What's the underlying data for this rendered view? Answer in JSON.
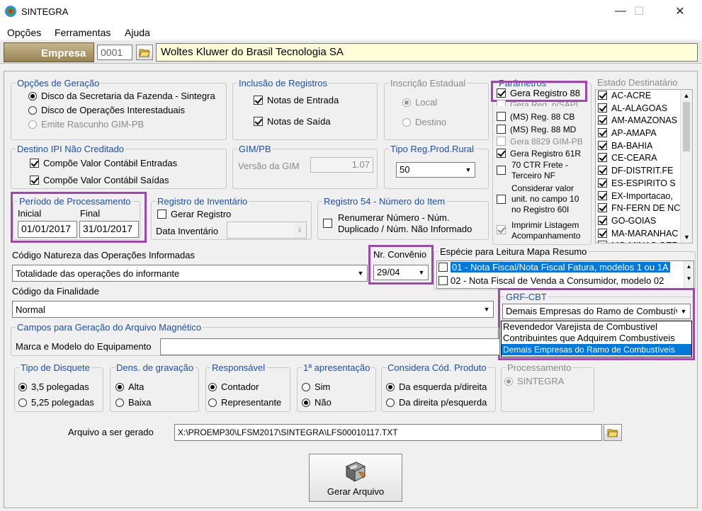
{
  "window": {
    "title": "SINTEGRA",
    "minimize": "—",
    "maximize": "☐",
    "close": "✕"
  },
  "menu": [
    "Opções",
    "Ferramentas",
    "Ajuda"
  ],
  "empresa": {
    "label": "Empresa",
    "code": "0001",
    "name": "Woltes Kluwer do Brasil Tecnologia SA"
  },
  "opcoes": {
    "legend": "Opções de Geração",
    "items": [
      "Disco da Secretaria da Fazenda - Sintegra",
      "Disco de Operações Interestaduais",
      "Emite Rascunho GIM-PB"
    ]
  },
  "inclusao": {
    "legend": "Inclusão de Registros",
    "items": [
      "Notas de Entrada",
      "Notas de Saída"
    ]
  },
  "inscricao": {
    "legend": "Inscrição Estadual",
    "items": [
      "Local",
      "Destino"
    ]
  },
  "parametros": {
    "legend": "Parâmetros",
    "items": [
      "Gera Registro 88",
      "Gera Reg. p/SAPI",
      "(MS) Reg. 88 CB",
      "(MS) Reg. 88 MD",
      "Gera 8829 GIM-PB",
      "Gera Registro 61R",
      "70 CTR Frete - Terceiro NF",
      "Considerar valor unit. no campo 10 no Registro 60I",
      "Imprimir Listagem Acompanhamento"
    ]
  },
  "estado": {
    "legend": "Estado Destinatário",
    "items": [
      "AC-ACRE",
      "AL-ALAGOAS",
      "AM-AMAZONAS",
      "AP-AMAPA",
      "BA-BAHIA",
      "CE-CEARA",
      "DF-DISTRIT.FE",
      "ES-ESPIRITO S",
      "EX-Importacao,",
      "FN-FERN DE NC",
      "GO-GOIAS",
      "MA-MARANHAC",
      "MG-MINAS GER"
    ]
  },
  "destino_ipi": {
    "legend": "Destino IPI Não Creditado",
    "items": [
      "Compõe Valor Contábil Entradas",
      "Compõe Valor Contábil Saídas"
    ]
  },
  "gimpb": {
    "legend": "GIM/PB",
    "label": "Versão da GIM",
    "value": "1.07"
  },
  "tipo_rural": {
    "legend": "Tipo Reg.Prod.Rural",
    "value": "50"
  },
  "periodo": {
    "legend": "Período de Processamento",
    "inicial_label": "Inicial",
    "final_label": "Final",
    "inicial": "01/01/2017",
    "final": "31/01/2017"
  },
  "inventario": {
    "legend": "Registro de Inventário",
    "gerar": "Gerar Registro",
    "data_label": "Data Inventário"
  },
  "reg54": {
    "legend": "Registro 54 - Número do Item",
    "text1": "Renumerar Número - Núm.",
    "text2": "Duplicado / Núm. Não Informado"
  },
  "natureza": {
    "label": "Código Natureza das Operações Informadas",
    "value": "Totalidade das operações do informante"
  },
  "convenio": {
    "label": "Nr. Convênio",
    "value": "29/04"
  },
  "especie": {
    "label": "Espécie para Leitura Mapa Resumo",
    "items": [
      {
        "code": "01",
        "text": "- Nota Fiscal/Nota Fiscal Fatura, modelos 1 ou 1A"
      },
      {
        "code": "02",
        "text": "- Nota Fiscal de Venda a Consumidor, modelo 02"
      }
    ]
  },
  "finalidade": {
    "label": "Código da Finalidade",
    "value": "Normal"
  },
  "grf": {
    "legend": "GRF-CBT",
    "value": "Demais Empresas do Ramo de Combustíveis",
    "options": [
      "Revendedor Varejista de Combustível",
      "Contribuintes que Adquirem Combustíveis",
      "Demais Empresas do Ramo de Combustíveis"
    ]
  },
  "campos": {
    "legend": "Campos para Geração do Arquivo Magnético",
    "marca_label": "Marca e Modelo do Equipamento"
  },
  "disquete": {
    "legend": "Tipo de Disquete",
    "items": [
      "3,5 polegadas",
      "5,25 polegadas"
    ]
  },
  "densidade": {
    "legend": "Dens. de gravação",
    "items": [
      "Alta",
      "Baixa"
    ]
  },
  "responsavel": {
    "legend": "Responsável",
    "items": [
      "Contador",
      "Representante"
    ]
  },
  "apresentacao": {
    "legend": "1ª apresentação",
    "items": [
      "Sim",
      "Não"
    ]
  },
  "produto": {
    "legend": "Considera Cód. Produto",
    "items": [
      "Da esquerda p/direita",
      "Da direita p/esquerda"
    ]
  },
  "processamento": {
    "legend": "Processamento",
    "items": [
      "SINTEGRA"
    ]
  },
  "arquivo": {
    "label": "Arquivo a ser gerado",
    "path": "X:\\PROEMP30\\LFSM2017\\SINTEGRA\\LFS00010117.TXT"
  },
  "gerar": {
    "label": "Gerar Arquivo"
  },
  "colors": {
    "highlight": "#9b4aa6",
    "selection": "#0078d7",
    "legend": "#1c4fa2",
    "empresa_field": "#fffed8"
  }
}
